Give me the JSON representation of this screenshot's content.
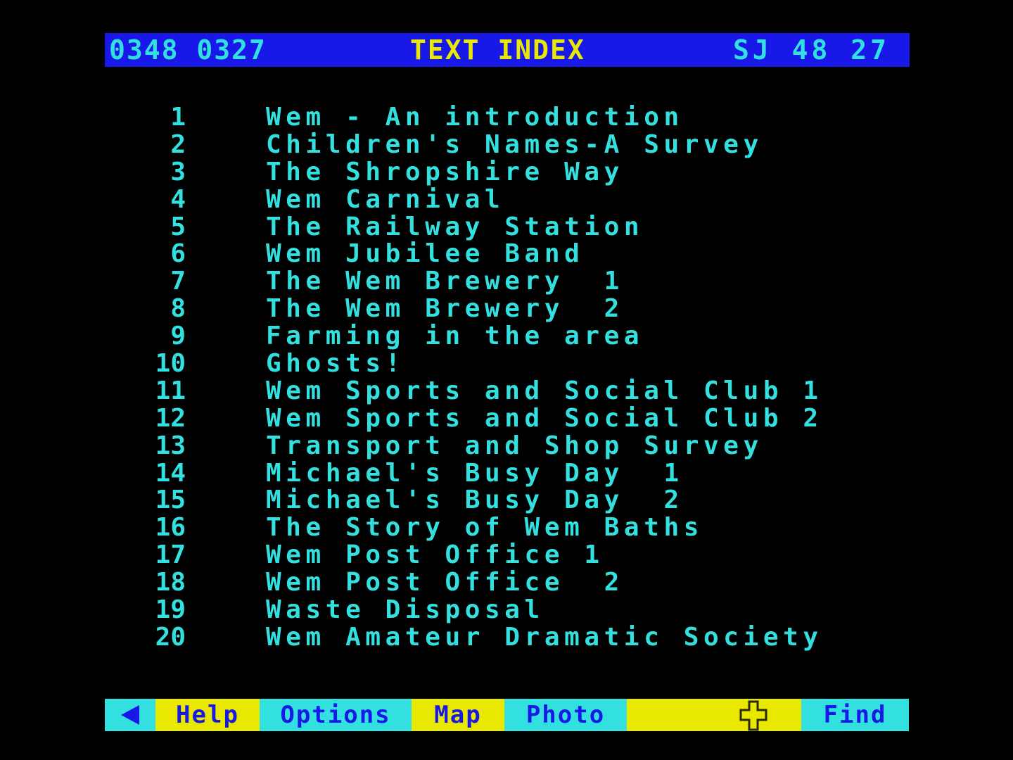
{
  "header": {
    "left": "0348 0327",
    "title": "TEXT INDEX",
    "right": "SJ 48 27"
  },
  "index": [
    {
      "num": "1",
      "title": "Wem - An introduction"
    },
    {
      "num": "2",
      "title": "Children's Names-A Survey"
    },
    {
      "num": "3",
      "title": "The Shropshire Way"
    },
    {
      "num": "4",
      "title": "Wem Carnival"
    },
    {
      "num": "5",
      "title": "The Railway Station"
    },
    {
      "num": "6",
      "title": "Wem Jubilee Band"
    },
    {
      "num": "7",
      "title": "The Wem Brewery  1"
    },
    {
      "num": "8",
      "title": "The Wem Brewery  2"
    },
    {
      "num": "9",
      "title": "Farming in the area"
    },
    {
      "num": "10",
      "title": "Ghosts!"
    },
    {
      "num": "11",
      "title": "Wem Sports and Social Club 1"
    },
    {
      "num": "12",
      "title": "Wem Sports and Social Club 2"
    },
    {
      "num": "13",
      "title": "Transport and Shop Survey"
    },
    {
      "num": "14",
      "title": "Michael's Busy Day  1"
    },
    {
      "num": "15",
      "title": "Michael's Busy Day  2"
    },
    {
      "num": "16",
      "title": "The Story of Wem Baths"
    },
    {
      "num": "17",
      "title": "Wem Post Office 1"
    },
    {
      "num": "18",
      "title": "Wem Post Office  2"
    },
    {
      "num": "19",
      "title": "Waste Disposal"
    },
    {
      "num": "20",
      "title": "Wem Amateur Dramatic Society"
    }
  ],
  "footer": {
    "back_icon": "left-triangle-icon",
    "help": "Help",
    "options": "Options",
    "map": "Map",
    "photo": "Photo",
    "pointer_icon": "cross-pointer-icon",
    "find": "Find"
  },
  "colors": {
    "background": "#000000",
    "header_bg": "#1818e8",
    "text_cyan": "#33e0e0",
    "text_yellow": "#e8e800",
    "footer_cyan": "#33e0e0",
    "footer_yellow": "#e8e800"
  }
}
